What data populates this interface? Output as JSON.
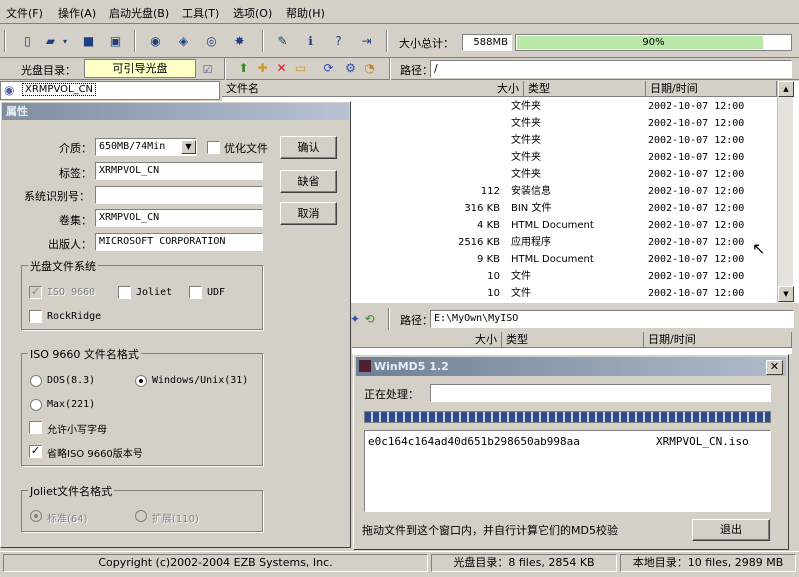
{
  "menu": [
    "文件(F)",
    "操作(A)",
    "启动光盘(B)",
    "工具(T)",
    "选项(O)",
    "帮助(H)"
  ],
  "toolbar": {
    "total_size_label": "大小总计：",
    "total_size_value": "588MB",
    "progress_percent": 90,
    "progress_text": "90%"
  },
  "disc": {
    "label": "光盘目录：",
    "boot_button": "可引导光盘",
    "path_label": "路径：",
    "path_value": "/",
    "volume_name": "XRMPVOL_CN"
  },
  "file_list": {
    "columns": [
      "文件名",
      "大小",
      "类型",
      "日期/时间"
    ],
    "rows": [
      {
        "size": "",
        "type": "文件夹",
        "date": "2002-10-07 12:00"
      },
      {
        "size": "",
        "type": "文件夹",
        "date": "2002-10-07 12:00"
      },
      {
        "size": "",
        "type": "文件夹",
        "date": "2002-10-07 12:00"
      },
      {
        "size": "",
        "type": "文件夹",
        "date": "2002-10-07 12:00"
      },
      {
        "size": "",
        "type": "文件夹",
        "date": "2002-10-07 12:00"
      },
      {
        "size": "112",
        "type": "安装信息",
        "date": "2002-10-07 12:00"
      },
      {
        "size": "316 KB",
        "type": "BIN 文件",
        "date": "2002-10-07 12:00"
      },
      {
        "size": "4 KB",
        "type": "HTML Document",
        "date": "2002-10-07 12:00"
      },
      {
        "size": "2516 KB",
        "type": "应用程序",
        "date": "2002-10-07 12:00"
      },
      {
        "size": "9 KB",
        "type": "HTML Document",
        "date": "2002-10-07 12:00"
      },
      {
        "size": "10",
        "type": "文件",
        "date": "2002-10-07 12:00"
      },
      {
        "size": "10",
        "type": "文件",
        "date": "2002-10-07 12:00"
      }
    ]
  },
  "local": {
    "path_label": "路径：",
    "path_value": "E:\\MyOwn\\MyISO",
    "columns": [
      "大小",
      "类型",
      "日期/时间"
    ]
  },
  "properties": {
    "title": "属性",
    "media_label": "介质：",
    "media_value": "650MB/74Min",
    "optimize_label": "优化文件",
    "volume_label_label": "标签：",
    "volume_label_value": "XRMPVOL_CN",
    "system_id_label": "系统识别号：",
    "system_id_value": "",
    "volume_set_label": "卷集：",
    "volume_set_value": "XRMPVOL_CN",
    "publisher_label": "出版人：",
    "publisher_value": "MICROSOFT CORPORATION",
    "ok_button": "确认",
    "default_button": "缺省",
    "cancel_button": "取消",
    "fs_group": "光盘文件系统",
    "fs_iso": "ISO 9660",
    "fs_joliet": "Joliet",
    "fs_udf": "UDF",
    "fs_rockridge": "RockRidge",
    "iso_group": "ISO 9660 文件名格式",
    "iso_dos": "DOS(8.3)",
    "iso_windows": "Windows/Unix(31)",
    "iso_max": "Max(221)",
    "iso_lowercase": "允许小写字母",
    "iso_omit_version": "省略ISO 9660版本号",
    "joliet_group": "Joliet文件名格式",
    "joliet_standard": "标准(64)",
    "joliet_extended": "扩展(110)"
  },
  "md5": {
    "title": "WinMD5 1.2",
    "processing_label": "正在处理：",
    "hash": "e0c164c164ad40d651b298650ab998aa",
    "filename": "XRMPVOL_CN.iso",
    "hint": "拖动文件到这个窗口内，并自行计算它们的MD5校验",
    "exit_button": "退出"
  },
  "status": {
    "copyright": "Copyright (c)2002-2004 EZB Systems, Inc.",
    "disc_summary": "光盘目录：8 files, 2854 KB",
    "local_summary": "本地目录：10 files, 2989 MB"
  }
}
